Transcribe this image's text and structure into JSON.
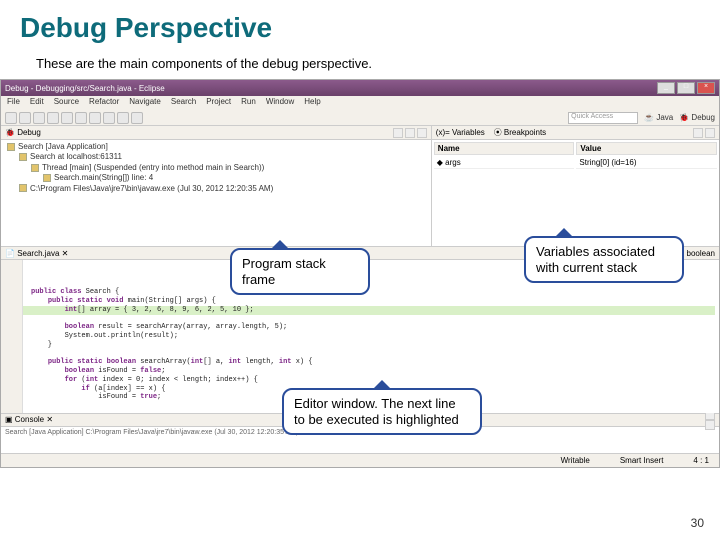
{
  "slide": {
    "title": "Debug Perspective",
    "subtitle": "These are the main components of the debug perspective.",
    "page_number": "30"
  },
  "window": {
    "title": "Debug - Debugging/src/Search.java - Eclipse"
  },
  "menu": {
    "file": "File",
    "edit": "Edit",
    "source": "Source",
    "refactor": "Refactor",
    "navigate": "Navigate",
    "search": "Search",
    "project": "Project",
    "run": "Run",
    "window": "Window",
    "help": "Help"
  },
  "toolbar": {
    "quick_access": "Quick Access",
    "persp_java": "Java",
    "persp_debug": "Debug"
  },
  "debug_view": {
    "tab_label": "Debug",
    "tree": {
      "app": "Search [Java Application]",
      "host": "Search at localhost:61311",
      "thread": "Thread [main] (Suspended (entry into method main in Search))",
      "frame": "Search.main(String[]) line: 4",
      "jvm": "C:\\Program Files\\Java\\jre7\\bin\\javaw.exe (Jul 30, 2012 12:20:35 AM)"
    }
  },
  "variables_view": {
    "tab_variables": "Variables",
    "tab_breakpoints": "Breakpoints",
    "col_name": "Name",
    "col_value": "Value",
    "rows": [
      {
        "name": "args",
        "value": "String[0] (id=16)"
      }
    ]
  },
  "editor": {
    "tab": "Search.java",
    "outline_label": "searchArray(int[], int, int) : boolean",
    "code_lines": [
      "",
      "public class Search {",
      "    public static void main(String[] args) {",
      "        int[] array = { 3, 2, 6, 8, 9, 6, 2, 5, 10 };",
      "        boolean result = searchArray(array, array.length, 5);",
      "        System.out.println(result);",
      "    }",
      "",
      "    public static boolean searchArray(int[] a, int length, int x) {",
      "        boolean isFound = false;",
      "        for (int index = 0; index < length; index++) {",
      "            if (a[index] == x) {",
      "                isFound = true;"
    ]
  },
  "console": {
    "tab": "Console",
    "text": "Search [Java Application] C:\\Program Files\\Java\\jre7\\bin\\javaw.exe (Jul 30, 2012 12:20:35 AM)"
  },
  "status": {
    "writable": "Writable",
    "insert": "Smart Insert",
    "pos": "4 : 1"
  },
  "callouts": {
    "program_stack": "Program stack frame",
    "variables": "Variables associated with current stack",
    "editor": "Editor window. The next line to be executed is highlighted"
  }
}
